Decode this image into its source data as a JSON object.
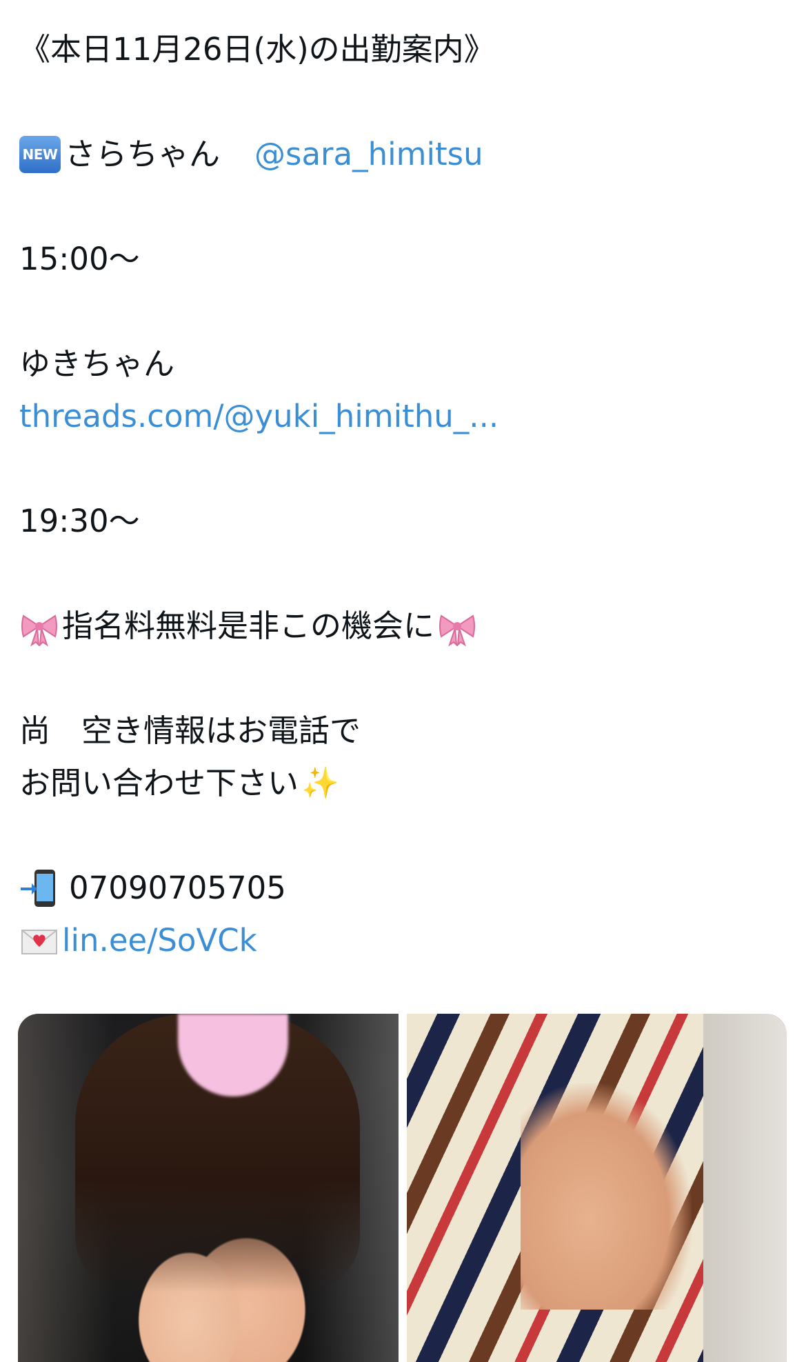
{
  "post": {
    "heading": "《本日11月26日(水)の出勤案内》",
    "cast1_name": "さらちゃん",
    "cast1_handle": "@sara_himitsu",
    "cast1_time": "15:00〜",
    "cast2_name": "ゆきちゃん",
    "cast2_link": "threads.com/@yuki_himithu_...",
    "cast2_time": "19:30〜",
    "promo": "指名料無料是非この機会に",
    "note_line1": "尚　空き情報はお電話で",
    "note_line2": "お問い合わせ下さい",
    "phone": "07090705705",
    "line_link": "lin.ee/SoVCk"
  },
  "icons": {
    "new_badge_label": "NEW",
    "new_badge": "new-badge-icon",
    "ribbon": "ribbon-icon",
    "sparkles": "sparkles-icon",
    "mobile_arrow": "mobile-phone-arrow-icon",
    "love_letter": "love-letter-icon"
  },
  "colors": {
    "text": "#0f1419",
    "link": "#3b8ed4"
  }
}
